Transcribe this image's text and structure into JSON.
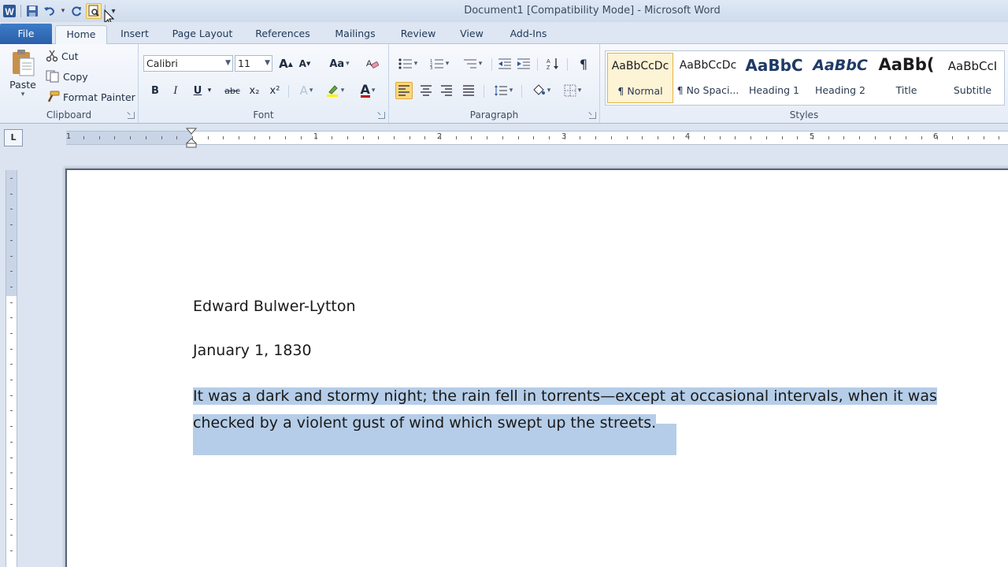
{
  "window": {
    "title": "Document1 [Compatibility Mode] - Microsoft Word"
  },
  "quick_access": {
    "icons": [
      "word-icon",
      "save-icon",
      "undo-icon",
      "redo-icon",
      "print-preview-icon",
      "customize-icon"
    ]
  },
  "tabs": {
    "file": "File",
    "home": "Home",
    "insert": "Insert",
    "page_layout": "Page Layout",
    "references": "References",
    "mailings": "Mailings",
    "review": "Review",
    "view": "View",
    "addins": "Add-Ins"
  },
  "clipboard": {
    "label": "Clipboard",
    "paste": "Paste",
    "cut": "Cut",
    "copy": "Copy",
    "format_painter": "Format Painter"
  },
  "font": {
    "label": "Font",
    "name": "Calibri",
    "size": "11",
    "bold": "B",
    "italic": "I",
    "underline": "U",
    "strike": "abc",
    "subscript": "x₂",
    "superscript": "x²",
    "change_case": "Aa",
    "grow": "A",
    "shrink": "A",
    "text_effects": "A",
    "font_color": "A"
  },
  "paragraph": {
    "label": "Paragraph",
    "pilcrow": "¶"
  },
  "styles": {
    "label": "Styles",
    "items": [
      {
        "preview": "AaBbCcDc",
        "name": "¶ Normal"
      },
      {
        "preview": "AaBbCcDc",
        "name": "¶ No Spaci..."
      },
      {
        "preview": "AaBbC",
        "name": "Heading 1"
      },
      {
        "preview": "AaBbC",
        "name": "Heading 2"
      },
      {
        "preview": "AaBb(",
        "name": "Title"
      },
      {
        "preview": "AaBbCcI",
        "name": "Subtitle"
      }
    ]
  },
  "ruler": {
    "tab_selector": "L",
    "numbers": [
      "1",
      "1",
      "2",
      "3",
      "4",
      "5",
      "6"
    ]
  },
  "document": {
    "author": "Edward Bulwer-Lytton",
    "date": "January 1, 1830",
    "paragraph_line1": "It was a dark and stormy night; the rain fell in torrents—except at occasional intervals, when it was",
    "paragraph_line2": "checked by a violent gust of wind which swept up the streets."
  },
  "colors": {
    "accent_file_tab": "#2a5fa8",
    "selection": "#b5cde8",
    "highlight_yellow": "#fbd87c"
  }
}
